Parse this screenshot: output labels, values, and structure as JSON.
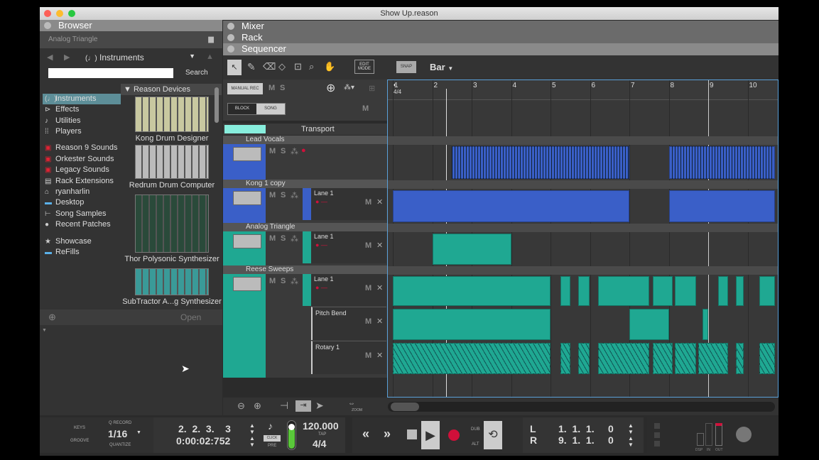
{
  "window": {
    "title": "Show Up.reason"
  },
  "browser": {
    "title": "Browser",
    "location": "Analog Triangle",
    "category": "Instruments",
    "search_placeholder": "",
    "search_label": "Search",
    "items": [
      {
        "label": "Instruments",
        "icon": "instrument-icon",
        "selected": true
      },
      {
        "label": "Effects",
        "icon": "effects-icon"
      },
      {
        "label": "Utilities",
        "icon": "utilities-icon"
      },
      {
        "label": "Players",
        "icon": "players-icon"
      },
      {
        "label": "Reason 9 Sounds",
        "icon": "soundbank-icon"
      },
      {
        "label": "Orkester Sounds",
        "icon": "soundbank-icon"
      },
      {
        "label": "Legacy Sounds",
        "icon": "soundbank-icon"
      },
      {
        "label": "Rack Extensions",
        "icon": "rack-extension-icon"
      },
      {
        "label": "ryanharlin",
        "icon": "home-icon"
      },
      {
        "label": "Desktop",
        "icon": "folder-icon"
      },
      {
        "label": "Song Samples",
        "icon": "song-samples-icon"
      },
      {
        "label": "Recent Patches",
        "icon": "recent-icon"
      },
      {
        "label": "Showcase",
        "icon": "star-icon"
      },
      {
        "label": "ReFills",
        "icon": "folder-icon"
      }
    ],
    "devices_header": "Reason Devices",
    "devices": [
      "Kong Drum Designer",
      "Redrum Drum Computer",
      "Thor Polysonic Synthesizer",
      "SubTractor A...g Synthesizer"
    ],
    "open_label": "Open"
  },
  "panels": {
    "mixer": "Mixer",
    "rack": "Rack",
    "sequencer": "Sequencer"
  },
  "toolbar": {
    "edit_mode": "EDIT MODE",
    "snap": "SNAP",
    "snap_value": "Bar",
    "manual_rec": "MANUAL REC",
    "m": "M",
    "s": "S",
    "block": "BLOCK",
    "song": "SONG"
  },
  "ruler": {
    "bars": [
      "1",
      "2",
      "3",
      "4",
      "5",
      "6",
      "7",
      "8",
      "9",
      "10"
    ],
    "signature": "4/4",
    "playhead_bar": 2.35,
    "loop_start_bar": 1,
    "loop_end_bar": 9
  },
  "tracks": [
    {
      "name": "Transport"
    },
    {
      "name": "Lead Vocals",
      "color": "#3a5fc8",
      "clips": [
        [
          2.5,
          7.0
        ],
        [
          8.0,
          10.7
        ]
      ]
    },
    {
      "name": "Kong 1 copy",
      "lane": "Lane 1",
      "color": "#3a5fc8",
      "clips": [
        [
          1,
          7.0
        ],
        [
          8.0,
          10.7
        ]
      ]
    },
    {
      "name": "Analog Triangle",
      "lane": "Lane 1",
      "color": "#1fa892",
      "clips": [
        [
          2,
          4
        ]
      ]
    },
    {
      "name": "Reese Sweeps",
      "lane": "Lane 1",
      "color": "#1fa892",
      "clips": [
        [
          1,
          5.0
        ],
        [
          5.25,
          5.5
        ],
        [
          5.7,
          6.0
        ],
        [
          6.2,
          7.5
        ],
        [
          7.6,
          8.1
        ],
        [
          8.15,
          8.7
        ],
        [
          9.25,
          9.5
        ],
        [
          9.7,
          9.9
        ],
        [
          10.3,
          10.7
        ]
      ],
      "automation": [
        {
          "name": "Pitch Bend",
          "clips": [
            [
              1,
              5.0
            ],
            [
              7.0,
              8.0
            ],
            [
              8.85,
              9.0
            ]
          ]
        },
        {
          "name": "Rotary 1",
          "clips": [
            [
              1,
              5.0
            ],
            [
              5.25,
              5.5
            ],
            [
              5.7,
              6.0
            ],
            [
              6.2,
              7.5
            ],
            [
              7.6,
              8.1
            ],
            [
              8.15,
              8.7
            ],
            [
              8.75,
              9.5
            ],
            [
              9.7,
              9.9
            ],
            [
              10.3,
              10.7
            ]
          ]
        }
      ]
    }
  ],
  "zoom_label": "ZOOM",
  "transport": {
    "keys": "KEYS",
    "groove": "GROOVE",
    "q_record": "Q RECORD",
    "quantize_value": "1/16",
    "quantize": "QUANTIZE",
    "position_bars": "2.  2.  3.    3",
    "position_time": "0:00:02:752",
    "click": "CLICK",
    "pre": "PRE",
    "tempo": "120.000",
    "tap": "TAP",
    "signature": "4/4",
    "dub": "DUB",
    "alt": "ALT",
    "loop_l_label": "L",
    "loop_l": "1.  1.  1.     0",
    "loop_r_label": "R",
    "loop_r": "9.  1.  1.     0",
    "dsp": "DSP",
    "in": "IN",
    "out": "OUT",
    "record_color": "#d0103a"
  }
}
